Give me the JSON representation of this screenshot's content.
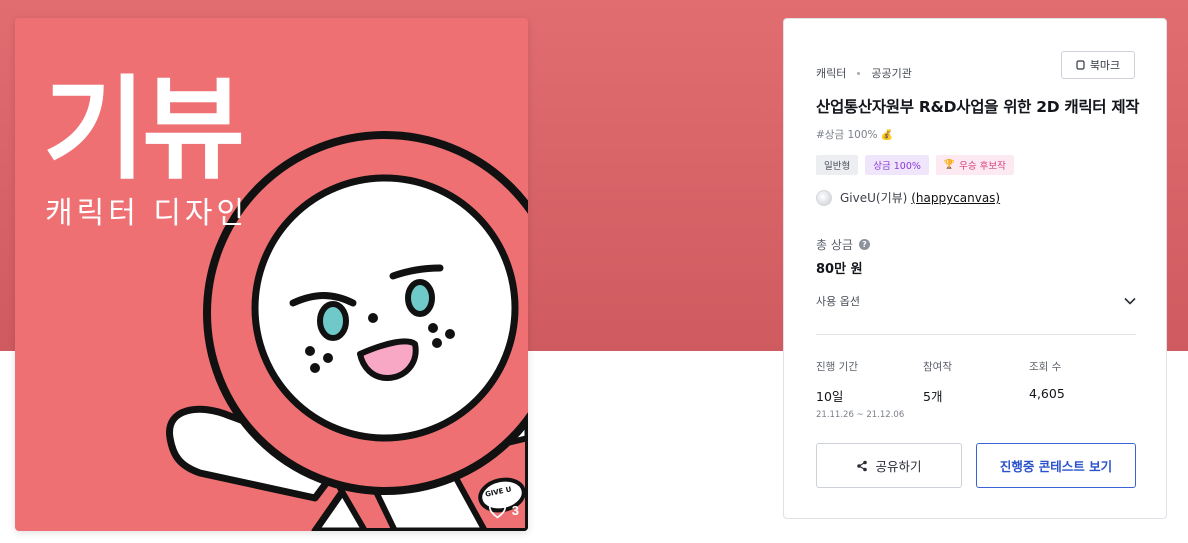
{
  "artwork": {
    "title": "기뷰",
    "subtitle": "캐릭터 디자인",
    "stamp": "GIVE U",
    "like_count": "3",
    "colors": {
      "background": "#ee7073",
      "banner": "#dc6a6d"
    }
  },
  "panel": {
    "breadcrumb": [
      "캐릭터",
      "공공기관"
    ],
    "bookmark_label": "북마크",
    "title": "산업통산자원부 R&D사업을 위한 2D 캐릭터 제작",
    "hashtag": "#상금 100%",
    "badges": [
      {
        "label": "일반형",
        "icon": ""
      },
      {
        "label": "상금 100%",
        "icon": ""
      },
      {
        "label": "우승 후보작",
        "icon": "trophy-icon"
      }
    ],
    "owner": {
      "name": "GiveU(기뷰)",
      "handle": "(happycanvas)"
    },
    "prize": {
      "label": "총 상금",
      "value": "80만 원"
    },
    "options_label": "사용 옵션",
    "stats": [
      {
        "label": "진행 기간",
        "value": "10일",
        "sub": "21.11.26 ~ 21.12.06"
      },
      {
        "label": "참여작",
        "value": "5개",
        "sub": ""
      },
      {
        "label": "조회 수",
        "value": "4,605",
        "sub": ""
      }
    ],
    "share_label": "공유하기",
    "view_label": "진행중 콘테스트 보기",
    "accent_color": "#2a52cc"
  }
}
